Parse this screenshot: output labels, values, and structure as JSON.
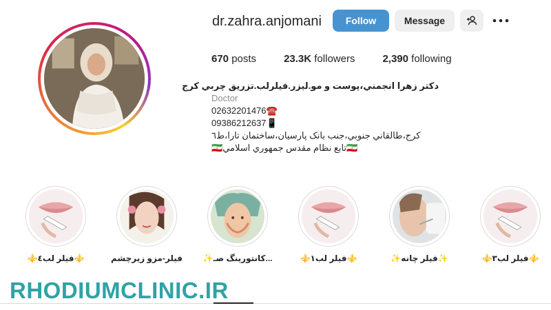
{
  "profile": {
    "username": "dr.zahra.anjomani",
    "follow_label": "Follow",
    "message_label": "Message",
    "add_user_icon": "add-user-icon",
    "more_icon": "more-icon"
  },
  "stats": {
    "posts_count": "670",
    "posts_label": "posts",
    "followers_count": "23.3K",
    "followers_label": "followers",
    "following_count": "2,390",
    "following_label": "following"
  },
  "bio": {
    "name": "دکتر زهرا انجمني،پوست و مو.ليزر.فيلرلب.تزريق چربي کرج",
    "category": "Doctor",
    "phone1": "02632201476☎️",
    "phone2": "09386212637📱",
    "address": "کرج،طالقاني جنوبي،جنب بانک پارسيان،ساختمان تارا،ط٦",
    "note": "🇮🇷تابع نظام مقدس جمهوري اسلامي🇮🇷"
  },
  "highlights": [
    {
      "label": "⚜️فيلر لب٤⚜️"
    },
    {
      "label": "فيلر-مزو زيرچشم"
    },
    {
      "label": "✨کانتورينگ صـ..."
    },
    {
      "label": "⚜️فيلر لب١⚜️"
    },
    {
      "label": "✨فيلر چانه✨"
    },
    {
      "label": "⚜️فيلر لب٣⚜️"
    }
  ],
  "watermark": "RHODIUMCLINIC.IR",
  "colors": {
    "follow_button": "#4793d1",
    "secondary_button": "#efefef",
    "watermark": "#2fa3a6",
    "text": "#262626",
    "muted": "#8e8e8e"
  }
}
